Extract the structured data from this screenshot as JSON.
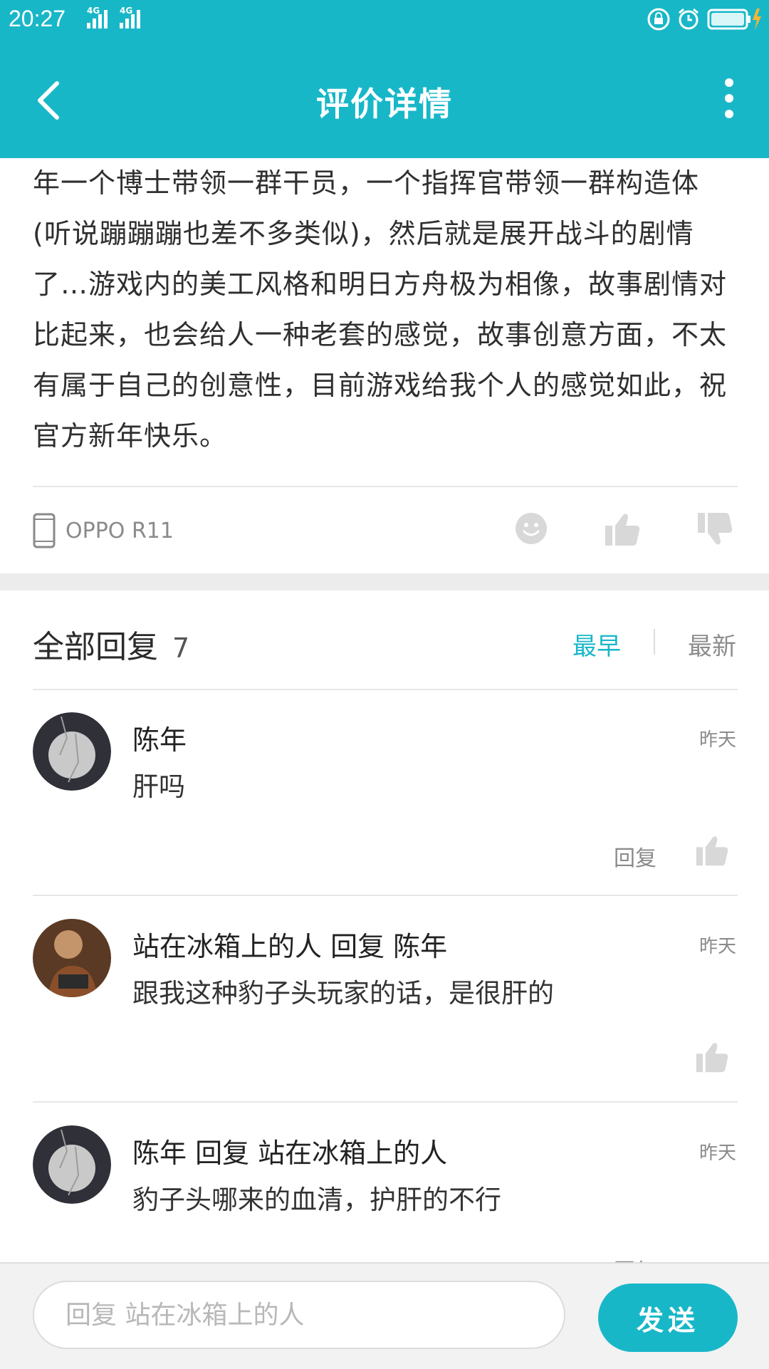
{
  "status_bar": {
    "time": "20:27",
    "network": [
      "4G",
      "4G"
    ]
  },
  "header": {
    "title": "评价详情"
  },
  "review": {
    "text": "年一个博士带领一群干员，一个指挥官带领一群构造体(听说蹦蹦蹦也差不多类似)，然后就是展开战斗的剧情了…游戏内的美工风格和明日方舟极为相像，故事剧情对比起来，也会给人一种老套的感觉，故事创意方面，不太有属于自己的创意性，目前游戏给我个人的感觉如此，祝官方新年快乐。",
    "device": "OPPO R11"
  },
  "replies": {
    "title": "全部回复",
    "count": "7",
    "sort_earliest": "最早",
    "sort_latest": "最新",
    "items": [
      {
        "author": "陈年",
        "text": "肝吗",
        "time": "昨天",
        "reply_label": "回复"
      },
      {
        "author": "站在冰箱上的人  回复  陈年",
        "text": "跟我这种豹子头玩家的话，是很肝的",
        "time": "昨天"
      },
      {
        "author": "陈年  回复  站在冰箱上的人",
        "text": "豹子头哪来的血清，护肝的不行",
        "time": "昨天",
        "reply_label": "回复"
      }
    ]
  },
  "composer": {
    "placeholder": "回复 站在冰箱上的人",
    "send_label": "发送"
  },
  "colors": {
    "accent": "#18b7c8",
    "divider": "#e7e7e7",
    "muted": "#8a8a8a"
  },
  "icons": [
    "back-icon",
    "more-icon",
    "phone-icon",
    "emoji-icon",
    "thumb-up-icon",
    "thumb-down-icon",
    "lock-rotation-icon",
    "alarm-icon",
    "battery-icon"
  ]
}
